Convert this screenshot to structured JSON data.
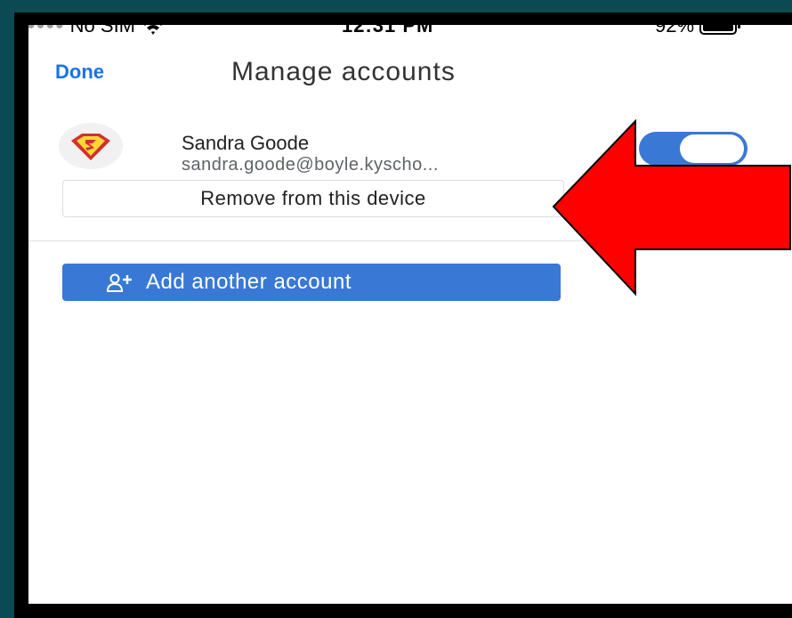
{
  "status_bar": {
    "carrier": "No SIM",
    "time": "12:31 PM",
    "battery": "92%"
  },
  "nav": {
    "done_label": "Done",
    "title": "Manage accounts"
  },
  "account": {
    "name": "Sandra Goode",
    "email": "sandra.goode@boyle.kyscho...",
    "toggle_on": true
  },
  "actions": {
    "remove_label": "Remove from this device",
    "add_label": "Add another account"
  },
  "colors": {
    "accent": "#1a73e8",
    "button_blue": "#3a78d6",
    "annotation_arrow": "#ff0000"
  },
  "icons": {
    "wifi": "wifi-icon",
    "battery": "battery-icon",
    "add_person": "add-person-icon",
    "avatar": "superman-logo-avatar"
  }
}
